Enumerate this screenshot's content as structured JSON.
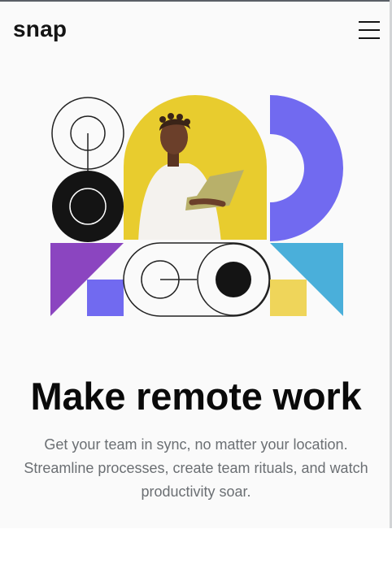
{
  "header": {
    "logo": "snap",
    "menu_icon": "hamburger-menu-icon"
  },
  "hero": {
    "headline": "Make remote work",
    "description": "Get your team in sync, no matter your location. Streamline processes, create team rituals, and watch productivity soar.",
    "image_subject": "person-with-laptop-illustration"
  },
  "colors": {
    "page_bg": "#fafafa",
    "yellow": "#e8cc2e",
    "purple": "#716af0",
    "violet": "#8b45c0",
    "sky_blue": "#4aafda",
    "soft_yellow": "#efd55a",
    "black": "#141414",
    "text_muted": "#6b6f73"
  }
}
